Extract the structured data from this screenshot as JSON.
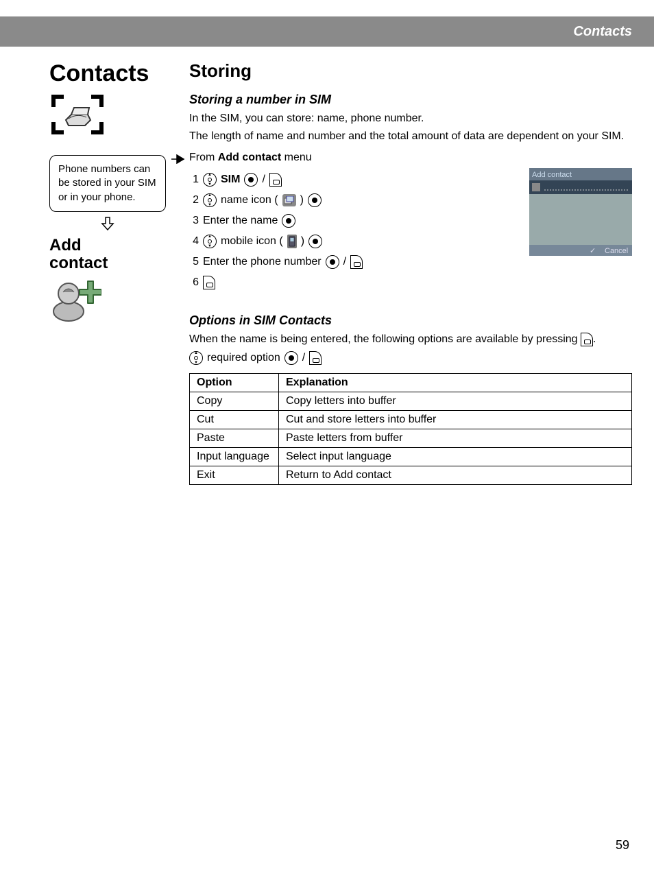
{
  "topbar": {
    "title": "Contacts"
  },
  "left": {
    "title": "Contacts",
    "note": "Phone numbers can be stored in your SIM or in your phone.",
    "add_label_line1": "Add",
    "add_label_line2": "contact"
  },
  "main": {
    "heading": "Storing",
    "sub1": "Storing a number in SIM",
    "p1": "In the SIM, you can store: name, phone number.",
    "p2": "The length of name and number and the total amount of data are dependent on your SIM.",
    "from_prefix": "From ",
    "from_bold": "Add contact",
    "from_suffix": " menu",
    "steps": {
      "s1_label": "SIM",
      "s2_prefix": "name icon (",
      "s2_suffix": ")",
      "s3": "Enter the name",
      "s4_prefix": "mobile icon (",
      "s4_suffix": ")",
      "s5": "Enter the phone number"
    },
    "screenshot": {
      "title": "Add contact",
      "left_soft": "✓",
      "right_soft": "Cancel"
    },
    "options": {
      "heading": "Options in SIM Contacts",
      "intro_prefix": "When the name is being entered, the following options are available by pressing ",
      "intro_suffix": ".",
      "required": " required option ",
      "table_head_option": "Option",
      "table_head_explanation": "Explanation",
      "rows": [
        {
          "option": "Copy",
          "explanation": "Copy letters into buffer"
        },
        {
          "option": "Cut",
          "explanation": "Cut and store letters into buffer"
        },
        {
          "option": "Paste",
          "explanation": "Paste letters from buffer"
        },
        {
          "option": "Input language",
          "explanation": "Select input language"
        },
        {
          "option": "Exit",
          "explanation": "Return to Add contact"
        }
      ]
    }
  },
  "page_number": "59"
}
